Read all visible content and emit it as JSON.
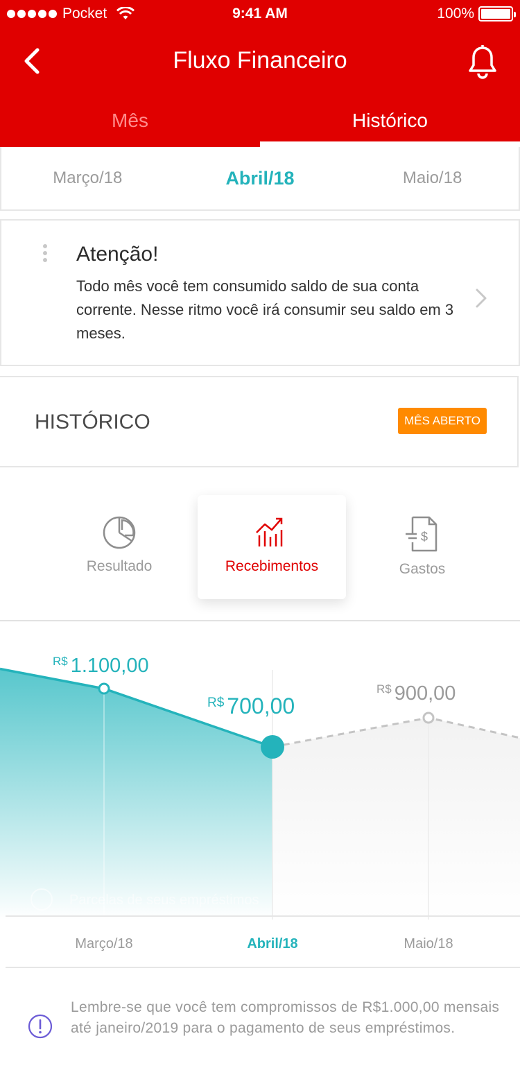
{
  "status_bar": {
    "carrier": "Pocket",
    "time": "9:41 AM",
    "battery": "100%"
  },
  "nav": {
    "title": "Fluxo Financeiro"
  },
  "tabs": [
    {
      "label": "Mês",
      "active": false
    },
    {
      "label": "Histórico",
      "active": true
    }
  ],
  "months": {
    "prev": "Março/18",
    "current": "Abril/18",
    "next": "Maio/18"
  },
  "alert": {
    "title": "Atenção!",
    "text": "Todo mês você tem consumido saldo de sua conta corrente. Nesse ritmo você irá consumir seu saldo em 3 meses."
  },
  "history": {
    "title": "HISTÓRICO",
    "badge": "MÊS ABERTO"
  },
  "categories": [
    {
      "label": "Resultado",
      "icon": "pie-chart-icon",
      "active": false
    },
    {
      "label": "Recebimentos",
      "icon": "growth-bars-icon",
      "active": true
    },
    {
      "label": "Gastos",
      "icon": "invoice-icon",
      "active": false
    }
  ],
  "colors": {
    "brand_red": "#e00000",
    "teal": "#24b3bb",
    "badge_orange": "#ff8a00",
    "muted_gray": "#9b9b9b"
  },
  "chart_data": {
    "type": "line",
    "categories": [
      "Março/18",
      "Abril/18",
      "Maio/18"
    ],
    "series": [
      {
        "values": [
          1100,
          700,
          900
        ]
      }
    ],
    "current_index": 1,
    "currency_prefix": "R$",
    "value_labels": [
      "1.100,00",
      "700,00",
      "900,00"
    ],
    "hidden_overlay_text": "Parcelas de seus empréstimos"
  },
  "reminder": {
    "text": "Lembre-se que você tem compromissos de R$1.000,00 mensais até janeiro/2019 para o pagamento de seus empréstimos."
  }
}
